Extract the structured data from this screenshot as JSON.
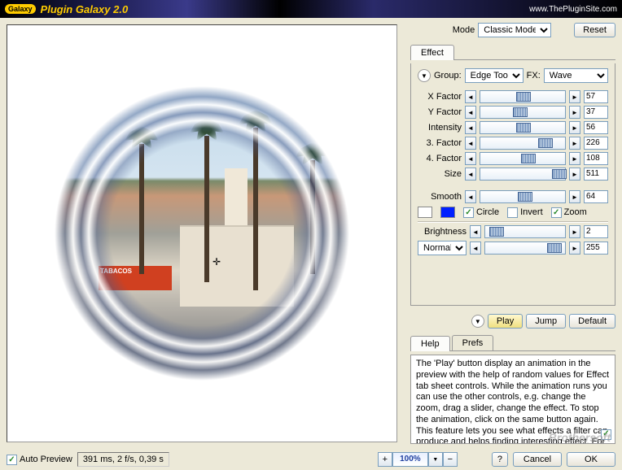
{
  "header": {
    "logo": "Galaxy",
    "title": "Plugin Galaxy 2.0",
    "url": "www.ThePluginSite.com"
  },
  "top": {
    "mode_label": "Mode",
    "mode_value": "Classic Mode",
    "reset": "Reset"
  },
  "tabs": {
    "effect": "Effect"
  },
  "group": {
    "label": "Group:",
    "value": "Edge Tool",
    "fx_label": "FX:",
    "fx_value": "Wave"
  },
  "sliders": [
    {
      "label": "X Factor",
      "value": "57",
      "pos": 42
    },
    {
      "label": "Y Factor",
      "value": "37",
      "pos": 38
    },
    {
      "label": "Intensity",
      "value": "56",
      "pos": 42
    },
    {
      "label": "3. Factor",
      "value": "226",
      "pos": 68
    },
    {
      "label": "4. Factor",
      "value": "108",
      "pos": 48
    },
    {
      "label": "Size",
      "value": "511",
      "pos": 85
    }
  ],
  "smooth": {
    "label": "Smooth",
    "value": "64",
    "pos": 44
  },
  "colors": {
    "white": "#ffffff",
    "blue": "#0020ff"
  },
  "checks": {
    "circle": "Circle",
    "invert": "Invert",
    "zoom": "Zoom"
  },
  "brightness": {
    "label": "Brightness",
    "value": "2",
    "pos": 5
  },
  "blend": {
    "mode": "Normal",
    "value": "255",
    "pos": 78
  },
  "anim": {
    "play": "Play",
    "jump": "Jump",
    "default": "Default"
  },
  "help_tabs": {
    "help": "Help",
    "prefs": "Prefs"
  },
  "help_text": "The 'Play' button display an animation in the preview with the help of random values for Effect tab sheet controls. While the animation runs you can use the other controls, e.g. change the zoom, drag a slider, change the effect. To stop the animation, click on the same button again. This feature lets you see what effects a filter can produce and helps finding interesting effect. For a smoother animation try decreasing the zoom",
  "bottom": {
    "auto_preview": "Auto Preview",
    "status": "391 ms, 2 f/s, 0,39 s",
    "zoom": "100%",
    "cancel": "Cancel",
    "ok": "OK"
  },
  "shop_sign": "TABACOS",
  "watermark": "Brothersoft"
}
